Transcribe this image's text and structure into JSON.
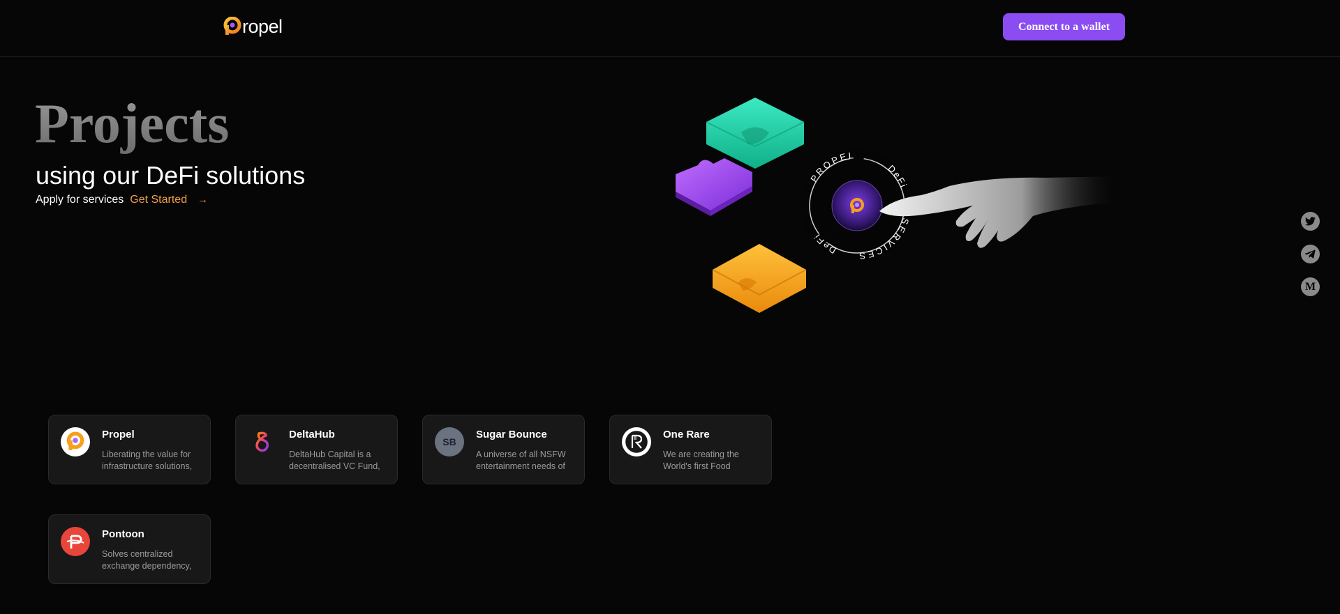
{
  "header": {
    "logo_text": "ropel",
    "wallet_button": "Connect to a wallet"
  },
  "hero": {
    "title": "Projects",
    "subtitle": "using our DeFi solutions",
    "apply_text": "Apply for services",
    "get_started": "Get Started",
    "arrow": "→"
  },
  "illustration": {
    "ring_top": "SERVICES",
    "ring_left": "DeFi",
    "ring_bottom": "PROPEL",
    "ring_right": "DeFi",
    "colors": {
      "green": "#1fe3b6",
      "purple": "#a04bf0",
      "orange": "#f6a01b"
    }
  },
  "socials": [
    "twitter-icon",
    "telegram-icon",
    "medium-icon"
  ],
  "cards": [
    {
      "name": "Propel",
      "description": "Liberating the value for infrastructure solutions,",
      "icon": "propel-logo-icon"
    },
    {
      "name": "DeltaHub",
      "description": "DeltaHub Capital is a decentralised VC Fund,",
      "icon": "deltahub-logo-icon"
    },
    {
      "name": "Sugar Bounce",
      "description": "A universe of all NSFW entertainment needs of",
      "icon": "sugar-bounce-avatar",
      "initials": "SB"
    },
    {
      "name": "One Rare",
      "description": "We are creating the World's first Food",
      "icon": "one-rare-logo-icon"
    },
    {
      "name": "Pontoon",
      "description": "Solves centralized exchange dependency,",
      "icon": "pontoon-logo-icon"
    }
  ],
  "colors": {
    "accent": "#8b4cf2",
    "link": "#f3a14a",
    "background": "#060606",
    "card": "#181818"
  }
}
